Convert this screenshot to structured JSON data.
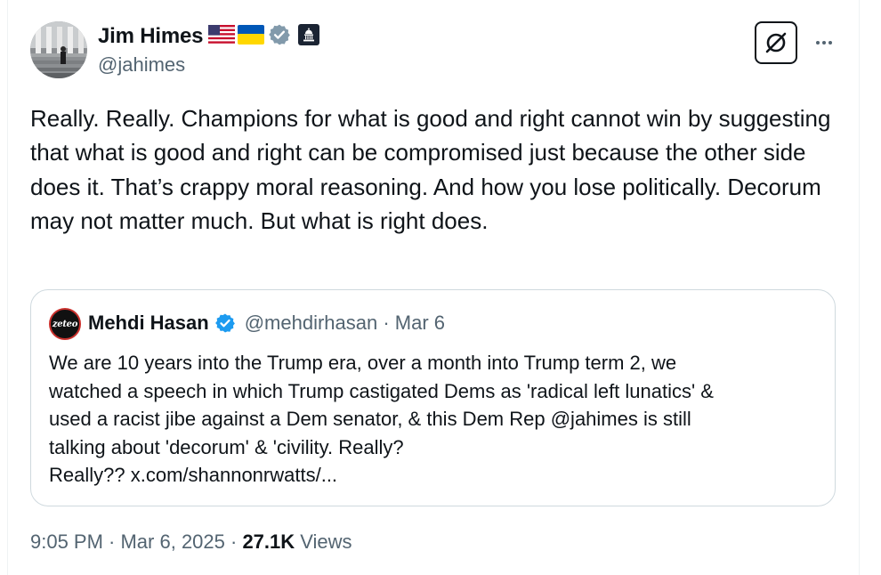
{
  "author": {
    "name": "Jim Himes",
    "handle": "@jahimes"
  },
  "tweet": {
    "text": "Really. Really. Champions for what is good and right cannot win by suggesting that what is good and right can be compromised just because the other side does it. That’s crappy moral reasoning. And how you lose politically. Decorum may not matter much. But what is right does."
  },
  "quoted": {
    "avatar_text": "zeteo",
    "name": "Mehdi Hasan",
    "handle_date": "@mehdirhasan · Mar 6",
    "text_lines": [
      "We are 10 years into the Trump era, over a month into Trump term 2,  we",
      "watched a speech in which Trump castigated Dems as 'radical left lunatics' &",
      "used a racist jibe against a Dem senator, & this Dem Rep @jahimes is still",
      "talking about 'decorum' & 'civility. Really?",
      "Really?? x.com/shannonrwatts/..."
    ]
  },
  "meta": {
    "time_date": "9:05 PM · Mar 6, 2025 · ",
    "views_count": "27.1K",
    "views_label": " Views"
  },
  "colors": {
    "verified_blue": "#1d9bf0",
    "verified_gray": "#829aab",
    "secondary_text": "#536471"
  }
}
